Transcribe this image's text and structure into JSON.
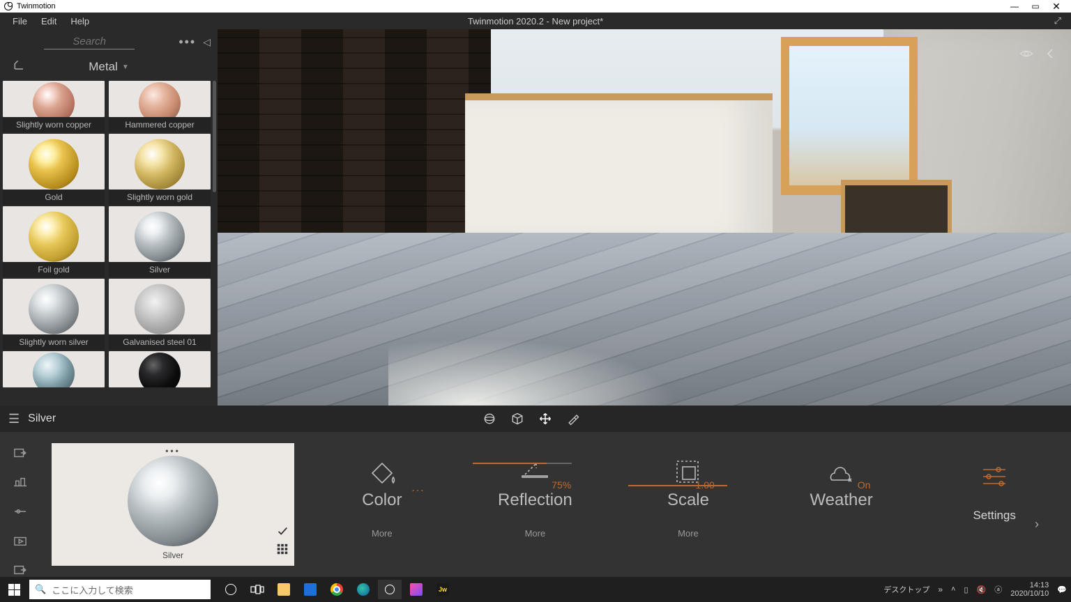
{
  "window": {
    "app_name": "Twinmotion",
    "title": "Twinmotion 2020.2 - New project*"
  },
  "menu": [
    "File",
    "Edit",
    "Help"
  ],
  "library": {
    "search_placeholder": "Search",
    "category": "Metal",
    "items": [
      {
        "label": "Slightly worn copper",
        "sphere": "g-copper-worn"
      },
      {
        "label": "Hammered copper",
        "sphere": "g-copper-ham"
      },
      {
        "label": "Gold",
        "sphere": "g-gold"
      },
      {
        "label": "Slightly worn gold",
        "sphere": "g-gold-worn"
      },
      {
        "label": "Foil gold",
        "sphere": "g-foilgold"
      },
      {
        "label": "Silver",
        "sphere": "g-silver"
      },
      {
        "label": "Slightly worn silver",
        "sphere": "g-silver-worn"
      },
      {
        "label": "Galvanised steel 01",
        "sphere": "g-galv"
      },
      {
        "label": "",
        "sphere": "g-bluesteel"
      },
      {
        "label": "",
        "sphere": "g-black"
      }
    ]
  },
  "selection": {
    "name": "Silver",
    "preview_label": "Silver"
  },
  "params": {
    "color": {
      "title": "Color",
      "dots": "...",
      "more": "More"
    },
    "reflection": {
      "title": "Reflection",
      "value": "75%",
      "more": "More"
    },
    "scale": {
      "title": "Scale",
      "value": "1.00",
      "more": "More"
    },
    "weather": {
      "title": "Weather",
      "value": "On"
    },
    "settings": {
      "title": "Settings"
    }
  },
  "taskbar": {
    "search_placeholder": "ここに入力して検索",
    "desktop_label": "デスクトップ",
    "time": "14:13",
    "date": "2020/10/10"
  }
}
